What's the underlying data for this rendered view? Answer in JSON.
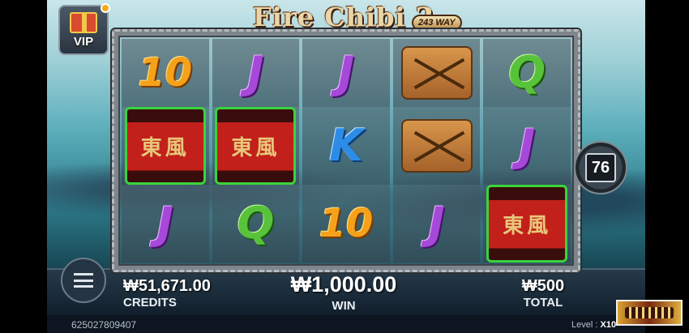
{
  "game": {
    "title": "Fire Chibi 2",
    "ways_badge": "243 WAY"
  },
  "vip": {
    "label": "VIP"
  },
  "reels": [
    [
      "10",
      "banner",
      "J"
    ],
    [
      "J",
      "banner",
      "Q"
    ],
    [
      "J",
      "K",
      "10"
    ],
    [
      "arrows",
      "arrows",
      "J"
    ],
    [
      "Q",
      "J",
      "banner"
    ]
  ],
  "banner_text": "東風",
  "counter": {
    "value": "76"
  },
  "credits": {
    "value": "₩51,671.00",
    "label": "CREDITS"
  },
  "win": {
    "value": "₩1,000.00",
    "label": "WIN"
  },
  "total": {
    "value": "₩500",
    "label": "TOTAL"
  },
  "round_id": "625027809407",
  "level": {
    "label": "Level :",
    "value": "X10"
  },
  "colors": {
    "ten": "#f5a21a",
    "jack": "#a649d8",
    "queen": "#58c23a",
    "king": "#2d8de6",
    "win_highlight": "#3bd33b"
  }
}
